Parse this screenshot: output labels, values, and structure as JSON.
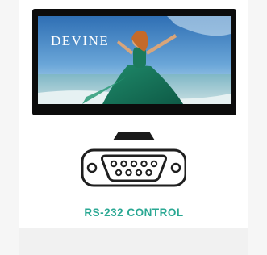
{
  "product": {
    "screen_brand_text": "DEVINE",
    "caption": "RS-232 CONTROL",
    "caption_color": "#2aa893",
    "image_description_icon": "monitor-icon",
    "connector_icon": "db9-serial-connector-icon"
  }
}
